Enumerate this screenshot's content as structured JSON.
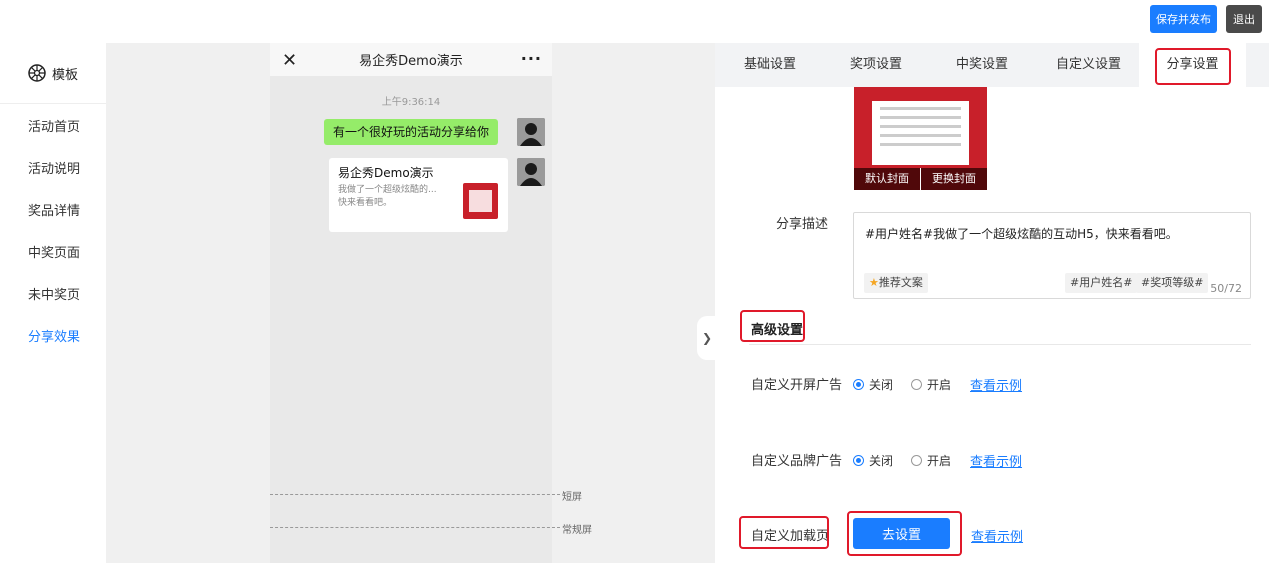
{
  "topbar": {
    "publish_label": "保存并发布",
    "exit_label": "退出"
  },
  "sidebar": {
    "template_label": "模板",
    "items": [
      {
        "label": "活动首页"
      },
      {
        "label": "活动说明"
      },
      {
        "label": "奖品详情"
      },
      {
        "label": "中奖页面"
      },
      {
        "label": "未中奖页"
      },
      {
        "label": "分享效果"
      }
    ],
    "active_item": "分享效果"
  },
  "preview": {
    "title": "易企秀Demo演示",
    "time": "上午9:36:14",
    "message": "有一个很好玩的活动分享给你",
    "card": {
      "title": "易企秀Demo演示",
      "desc_line1": "我做了一个超级炫酷的...",
      "desc_line2": "快来看看吧。"
    },
    "short_screen_label": "短屏",
    "normal_screen_label": "常规屏"
  },
  "panel": {
    "tabs": [
      {
        "label": "基础设置"
      },
      {
        "label": "奖项设置"
      },
      {
        "label": "中奖设置"
      },
      {
        "label": "自定义设置"
      },
      {
        "label": "分享设置"
      }
    ],
    "active_tab": "分享设置",
    "cover": {
      "default_label": "默认封面",
      "change_label": "更换封面"
    },
    "share_desc": {
      "label": "分享描述",
      "value": "#用户姓名#我做了一个超级炫酷的互动H5，快来看看吧。",
      "recommend_label": "推荐文案",
      "tag_name": "#用户姓名#",
      "tag_level": "#奖项等级#",
      "counter": "50/72"
    },
    "advanced": {
      "title": "高级设置",
      "splash_ad": {
        "label": "自定义开屏广告",
        "off": "关闭",
        "on": "开启",
        "example": "查看示例",
        "value": "off"
      },
      "brand_ad": {
        "label": "自定义品牌广告",
        "off": "关闭",
        "on": "开启",
        "example": "查看示例",
        "value": "off"
      },
      "loading_page": {
        "label": "自定义加载页",
        "button": "去设置",
        "example": "查看示例"
      }
    }
  },
  "colors": {
    "accent": "#1a7dff",
    "highlight": "#e0192a",
    "bubble": "#95ec69"
  }
}
